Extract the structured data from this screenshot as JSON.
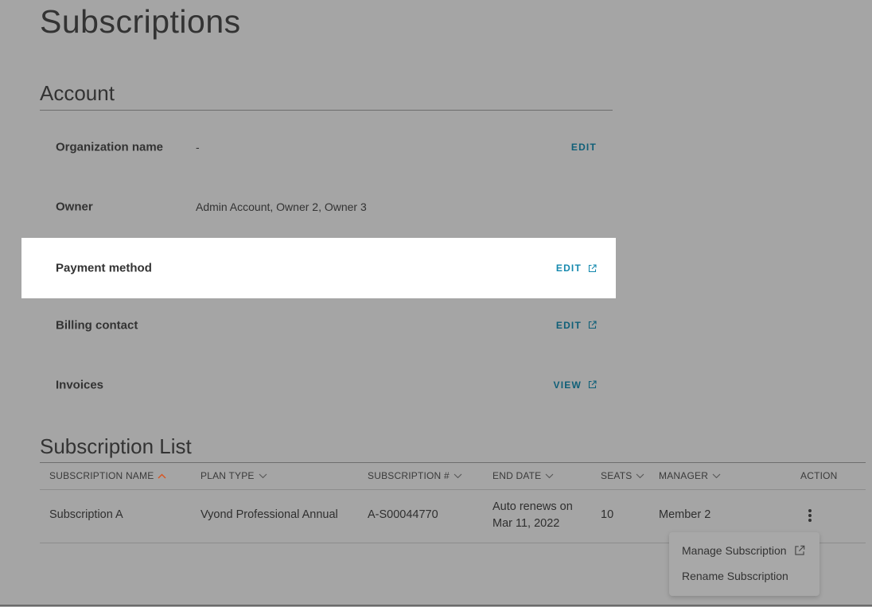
{
  "page": {
    "title": "Subscriptions"
  },
  "account": {
    "heading": "Account",
    "rows": [
      {
        "label": "Organization name",
        "value": "-",
        "action": "EDIT",
        "external": false
      },
      {
        "label": "Owner",
        "value": "Admin Account, Owner 2, Owner 3",
        "action": "",
        "external": false
      },
      {
        "label": "Payment method",
        "value": "",
        "action": "EDIT",
        "external": true,
        "highlighted": true
      },
      {
        "label": "Billing contact",
        "value": "",
        "action": "EDIT",
        "external": true
      },
      {
        "label": "Invoices",
        "value": "",
        "action": "VIEW",
        "external": true
      }
    ]
  },
  "subscription_list": {
    "heading": "Subscription List",
    "columns": [
      {
        "label": "SUBSCRIPTION NAME",
        "sort": "asc",
        "active": true
      },
      {
        "label": "PLAN TYPE",
        "sort": "none"
      },
      {
        "label": "SUBSCRIPTION #",
        "sort": "none"
      },
      {
        "label": "END DATE",
        "sort": "none"
      },
      {
        "label": "SEATS",
        "sort": "none"
      },
      {
        "label": "MANAGER",
        "sort": "none"
      },
      {
        "label": "ACTION",
        "sort": ""
      }
    ],
    "rows": [
      {
        "name": "Subscription A",
        "plan_type": "Vyond Professional Annual",
        "subscription_number": "A-S00044770",
        "end_date_line1": "Auto renews on",
        "end_date_line2": "Mar 11, 2022",
        "seats": "10",
        "manager": "Member 2"
      }
    ]
  },
  "action_menu": {
    "items": [
      {
        "label": "Manage Subscription",
        "icon": "external-link-icon"
      },
      {
        "label": "Rename Subscription"
      }
    ]
  },
  "colors": {
    "overlay_background": "#a5a5a5",
    "link": "#0f5f78",
    "link_highlight": "#1589ae",
    "sort_active": "#d9531e"
  }
}
